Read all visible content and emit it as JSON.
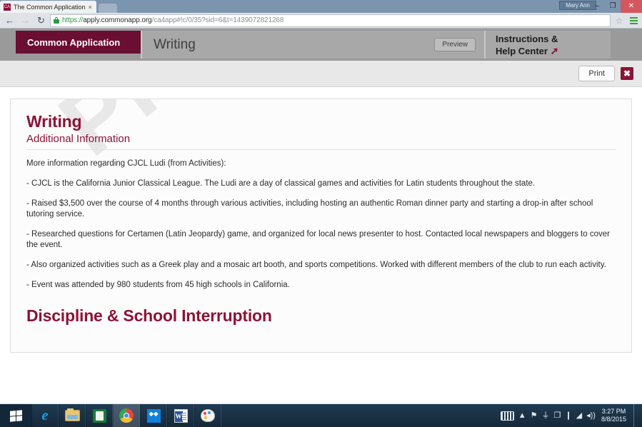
{
  "window": {
    "tab_title": "The Common Application",
    "tab_close_label": "×",
    "favicon_label": "CA",
    "user_label": "Mary Ann",
    "minimize_label": "–",
    "restore_label": "❐",
    "close_label": "✕"
  },
  "toolbar": {
    "back_label": "←",
    "forward_label": "→",
    "reload_label": "↻",
    "url_scheme": "https://",
    "url_host": "apply.commonapp.org",
    "url_path": "/ca4app#!c/0/35?sid=6&t=1439072821268",
    "star_label": "☆",
    "menu_label": "menu"
  },
  "app_bar": {
    "brand": "Common Application",
    "section_title": "Writing",
    "preview_label": "Preview",
    "help_line1": "Instructions &",
    "help_line2": "Help Center",
    "help_arrow": "➚"
  },
  "action_strip": {
    "print_label": "Print",
    "close_label": "✖"
  },
  "document": {
    "watermark": "PREVIEW",
    "heading": "Writing",
    "subheading": "Additional Information",
    "paragraphs": [
      "More information regarding CJCL Ludi (from Activities):",
      "- CJCL is the California Junior Classical League. The Ludi are a day of classical games and activities for Latin students throughout the state.",
      "- Raised $3,500 over the course of 4 months through various activities, including hosting an authentic Roman dinner party and starting a drop-in after school tutoring service.",
      "- Researched questions for Certamen (Latin Jeopardy) game, and organized for local news presenter to host. Contacted local newspapers and bloggers to cover the event.",
      "- Also organized activities such as a Greek play and a mosaic art booth, and sports competitions. Worked with different members of the club to run each activity.",
      "- Event was attended by 980 students from 45 high schools in California."
    ],
    "next_section_heading": "Discipline & School Interruption"
  },
  "taskbar": {
    "items": [
      {
        "name": "start",
        "label": "Start"
      },
      {
        "name": "internet-explorer",
        "label": "Internet Explorer"
      },
      {
        "name": "file-explorer",
        "label": "File Explorer"
      },
      {
        "name": "excel",
        "label": "Microsoft Excel"
      },
      {
        "name": "chrome",
        "label": "Google Chrome"
      },
      {
        "name": "dropbox",
        "label": "Dropbox"
      },
      {
        "name": "word",
        "label": "Microsoft Word"
      },
      {
        "name": "paint",
        "label": "Paint"
      }
    ],
    "tray": {
      "show_hidden": "▲",
      "flag": "⚑",
      "network": "⏚",
      "sync": "❐",
      "battery": "❙",
      "signal": "◢",
      "volume": "◂))",
      "time": "3:27 PM",
      "date": "8/8/2015"
    }
  },
  "colors": {
    "brand_maroon": "#8c1338",
    "brand_dark": "#6b0f32",
    "appbar_gray": "#9a9a9a"
  }
}
